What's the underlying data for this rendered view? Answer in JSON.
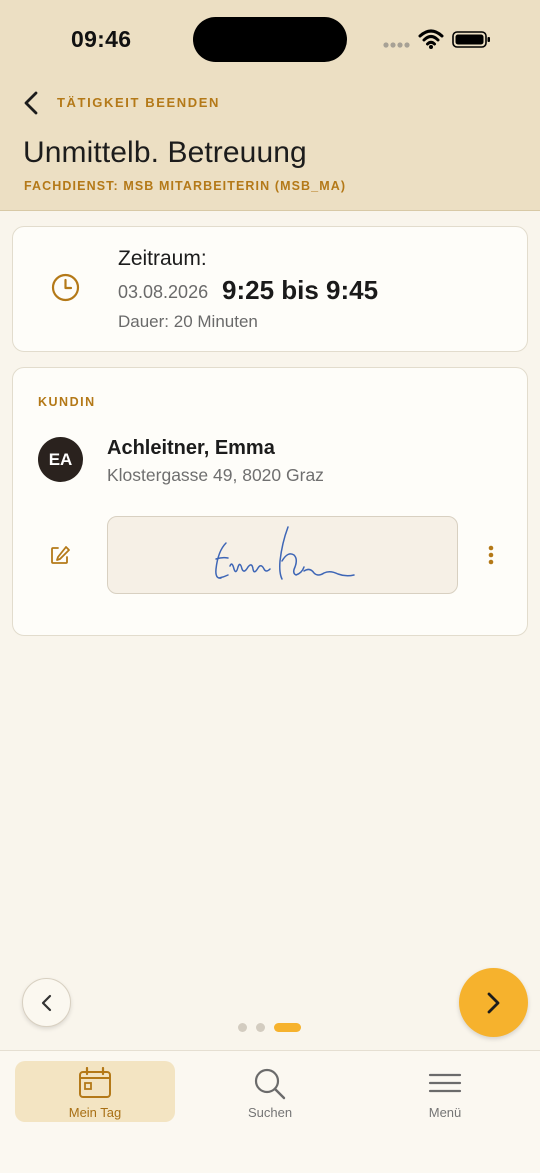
{
  "status_bar": {
    "time": "09:46"
  },
  "header": {
    "back_label": "TÄTIGKEIT BEENDEN",
    "title": "Unmittelb. Betreuung",
    "subtitle": "FACHDIENST: MSB MITARBEITERIN (MSB_MA)"
  },
  "time_card": {
    "label": "Zeitraum:",
    "date": "03.08.2026",
    "time_range": "9:25 bis 9:45",
    "duration": "Dauer: 20 Minuten"
  },
  "client_card": {
    "section_label": "KUNDIN",
    "initials": "EA",
    "name": "Achleitner, Emma",
    "address": "Klostergasse 49, 8020 Graz"
  },
  "pagination": {
    "pages": 3,
    "current_page": 3
  },
  "tabs": [
    {
      "label": "Mein Tag",
      "icon": "calendar-icon",
      "active": true
    },
    {
      "label": "Suchen",
      "icon": "search-icon",
      "active": false
    },
    {
      "label": "Menü",
      "icon": "menu-icon",
      "active": false
    }
  ],
  "colors": {
    "accent": "#b47918",
    "header_bg": "#ecdfc3",
    "page_bg": "#f9f5ec",
    "next_button": "#f6b22d",
    "signature_ink": "#3e66b6"
  }
}
